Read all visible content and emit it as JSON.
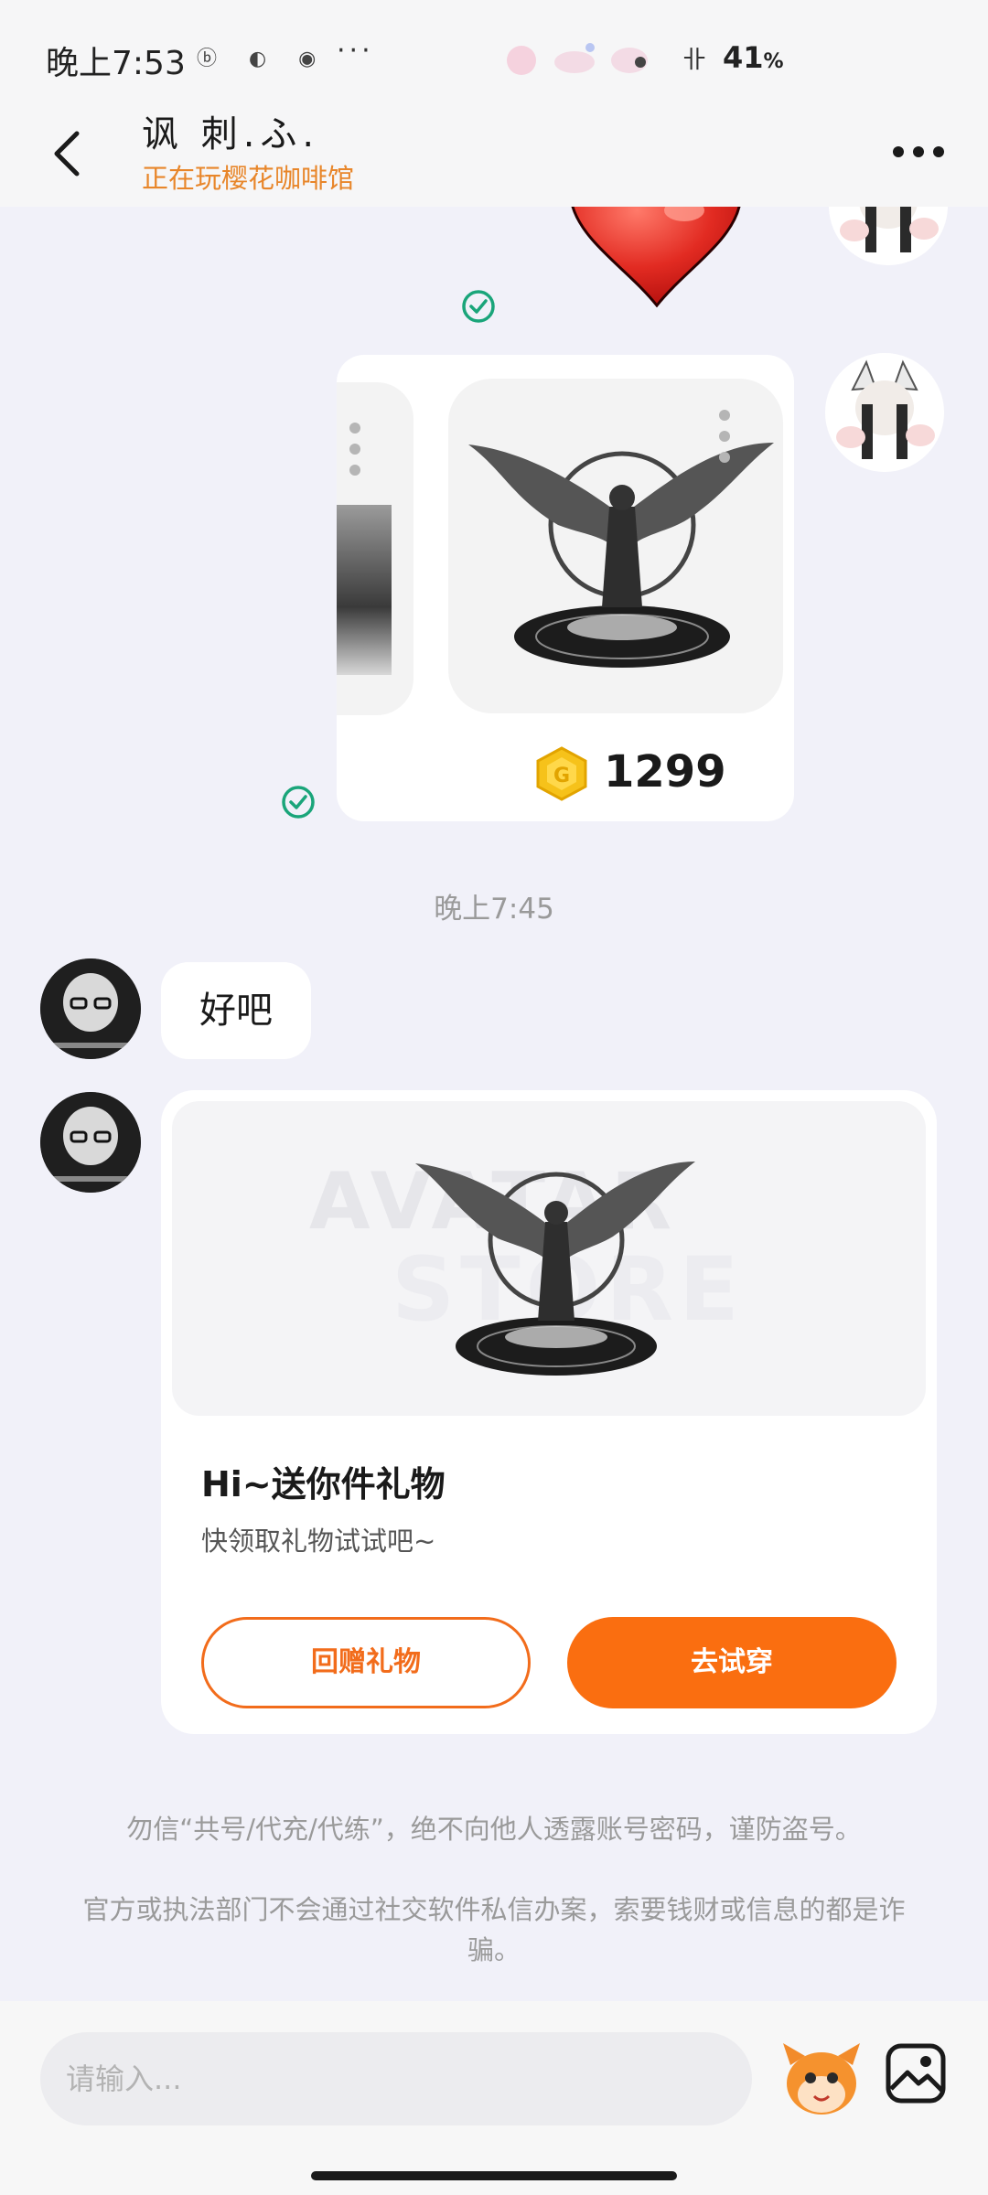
{
  "status_bar": {
    "time": "晚上7:53",
    "notification_icons": "ⓑ ◐ ◉",
    "more": "···",
    "battery": "41",
    "battery_unit": "%"
  },
  "header": {
    "contact_name": "讽 刺.ふ.",
    "contact_status": "正在玩樱花咖啡馆"
  },
  "chat": {
    "store_item": {
      "price": "1299"
    },
    "timestamp": "晚上7:45",
    "text_message": "好吧",
    "gift_card": {
      "title": "Hi~送你件礼物",
      "subtitle": "快领取礼物试试吧~",
      "return_gift_label": "回赠礼物",
      "try_on_label": "去试穿",
      "watermark_line1": "AVATAR",
      "watermark_line2": "STORE"
    },
    "notice_line1": "勿信“共号/代充/代练”，绝不向他人透露账号密码，谨防盗号。",
    "notice_line2": "官方或执法部门不会通过社交软件私信办案，索要钱财或信息的都是诈骗。"
  },
  "input_bar": {
    "placeholder": "请输入..."
  },
  "colors": {
    "accent": "#fa6e10",
    "status_orange": "#e8862a",
    "read_tick": "#1aa57a"
  }
}
